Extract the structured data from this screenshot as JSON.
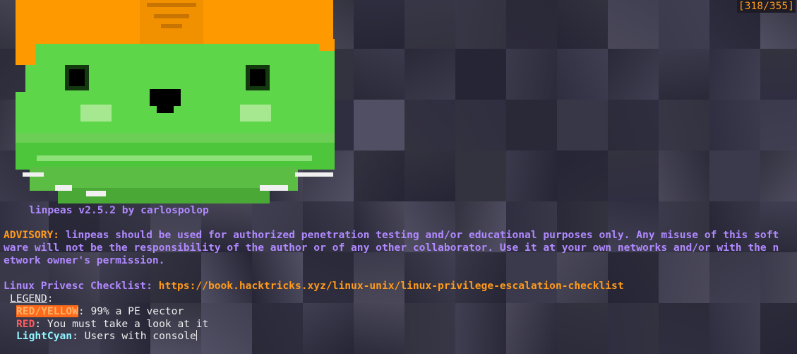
{
  "counter": "[318/355]",
  "banner": "linpeas v2.5.2 by carlospolop",
  "advisory": {
    "label": "ADVISORY:",
    "line1": " linpeas should be used for authorized penetration testing and/or educational purposes only. Any misuse of this soft",
    "line2": "ware will not be the responsibility of the author or of any other collaborator. Use it at your own networks and/or with the n",
    "line3": "etwork owner's permission."
  },
  "checklist": {
    "label": "Linux Privesc Checklist: ",
    "url": "https://book.hacktricks.xyz/linux-unix/linux-privilege-escalation-checklist"
  },
  "legend": {
    "title": "LEGEND",
    "colon": ":",
    "items": [
      {
        "key": "RED/YELLOW",
        "text": ": 99% a PE vector"
      },
      {
        "key": "RED",
        "text": ": You must take a look at it"
      },
      {
        "key": "LightCyan",
        "text": ": Users with console"
      }
    ]
  },
  "colors": {
    "background": "#262535",
    "purple": "#b089ff",
    "orange": "#ff9a1a",
    "cyan": "#8ff4ff",
    "red": "#ff5c5c",
    "peass_hat": "#ff9900",
    "peass_body": "#5ed64a"
  }
}
